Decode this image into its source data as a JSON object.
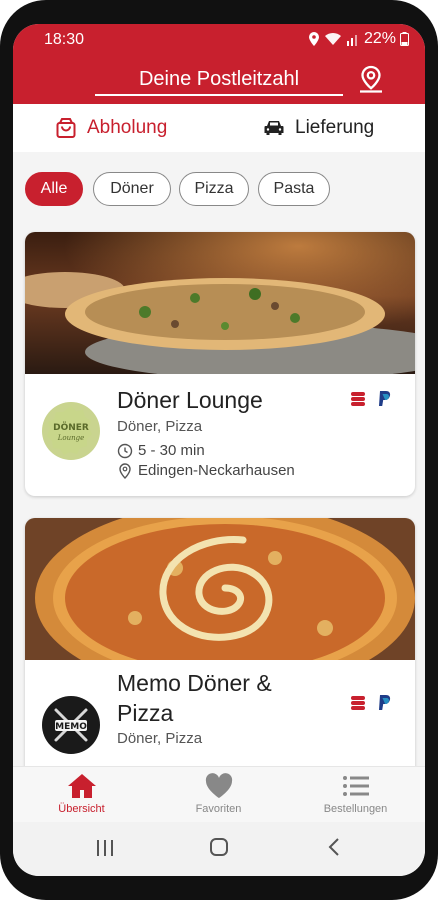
{
  "status_bar": {
    "time": "18:30",
    "battery": "22%"
  },
  "header": {
    "postal_placeholder": "Deine Postleitzahl"
  },
  "delivery_tabs": {
    "pickup": "Abholung",
    "delivery": "Lieferung"
  },
  "filters": [
    "Alle",
    "Döner",
    "Pizza",
    "Pasta"
  ],
  "restaurants": [
    {
      "name": "Döner Lounge",
      "categories": "Döner, Pizza",
      "time": "5 - 30 min",
      "location": "Edingen-Neckarhausen",
      "logo_text": "DÖNER Lounge"
    },
    {
      "name": "Memo Döner & Pizza",
      "categories": "Döner, Pizza",
      "logo_text": "MEMO"
    }
  ],
  "bottom_nav": {
    "overview": "Übersicht",
    "favorites": "Favoriten",
    "orders": "Bestellungen"
  },
  "colors": {
    "brand_red": "#c8202e",
    "paypal_blue": "#1f3c88"
  }
}
